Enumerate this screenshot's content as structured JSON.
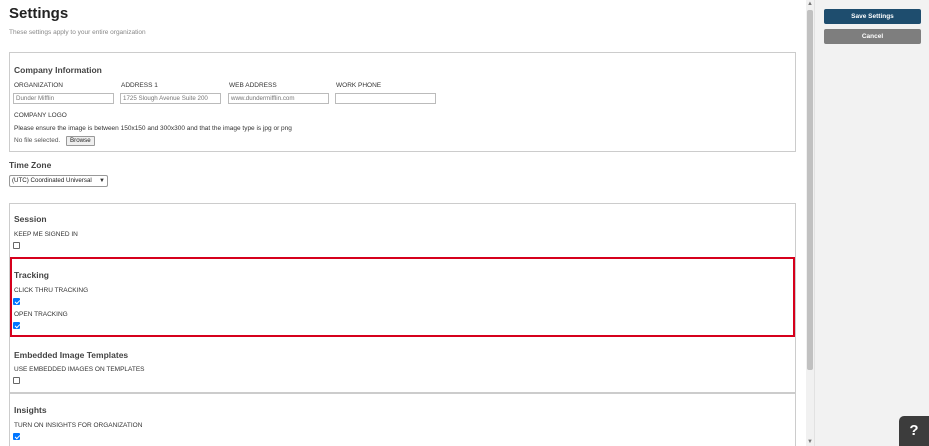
{
  "page": {
    "title": "Settings",
    "subtitle": "These settings apply to your entire organization"
  },
  "company": {
    "title": "Company Information",
    "organization": {
      "label": "ORGANIZATION",
      "value": "Dunder Mifflin"
    },
    "address": {
      "label": "ADDRESS 1",
      "value": "1725 Slough Avenue Suite 200"
    },
    "web": {
      "label": "WEB ADDRESS",
      "value": "www.dundermifflin.com"
    },
    "phone": {
      "label": "WORK PHONE",
      "value": ""
    },
    "logo_label": "COMPANY LOGO",
    "logo_hint": "Please ensure the image is between 150x150 and 300x300 and that the image type is jpg or png",
    "no_file": "No file selected.",
    "browse": "Browse"
  },
  "timezone": {
    "title": "Time Zone",
    "selected": "(UTC) Coordinated Universal"
  },
  "session": {
    "title": "Session",
    "keep_signed_in": {
      "label": "KEEP ME SIGNED IN",
      "checked": false
    }
  },
  "tracking": {
    "title": "Tracking",
    "click_thru": {
      "label": "CLICK THRU TRACKING",
      "checked": true
    },
    "open": {
      "label": "OPEN TRACKING",
      "checked": true
    }
  },
  "embedded": {
    "title": "Embedded Image Templates",
    "use_embedded": {
      "label": "USE EMBEDDED IMAGES ON TEMPLATES",
      "checked": false
    }
  },
  "insights": {
    "title": "Insights",
    "turn_on": {
      "label": "TURN ON INSIGHTS FOR ORGANIZATION",
      "checked": true
    }
  },
  "sidebar": {
    "save": "Save Settings",
    "cancel": "Cancel"
  },
  "help": {
    "label": "?"
  },
  "colors": {
    "primary": "#1e4d6e",
    "secondary": "#7e7e7e",
    "highlight": "#d6001c",
    "checkbox": "#0075ff"
  },
  "icons": {
    "select_chevron": "chevron-down-icon",
    "scroll_up": "triangle-up-icon",
    "scroll_down": "triangle-down-icon"
  }
}
